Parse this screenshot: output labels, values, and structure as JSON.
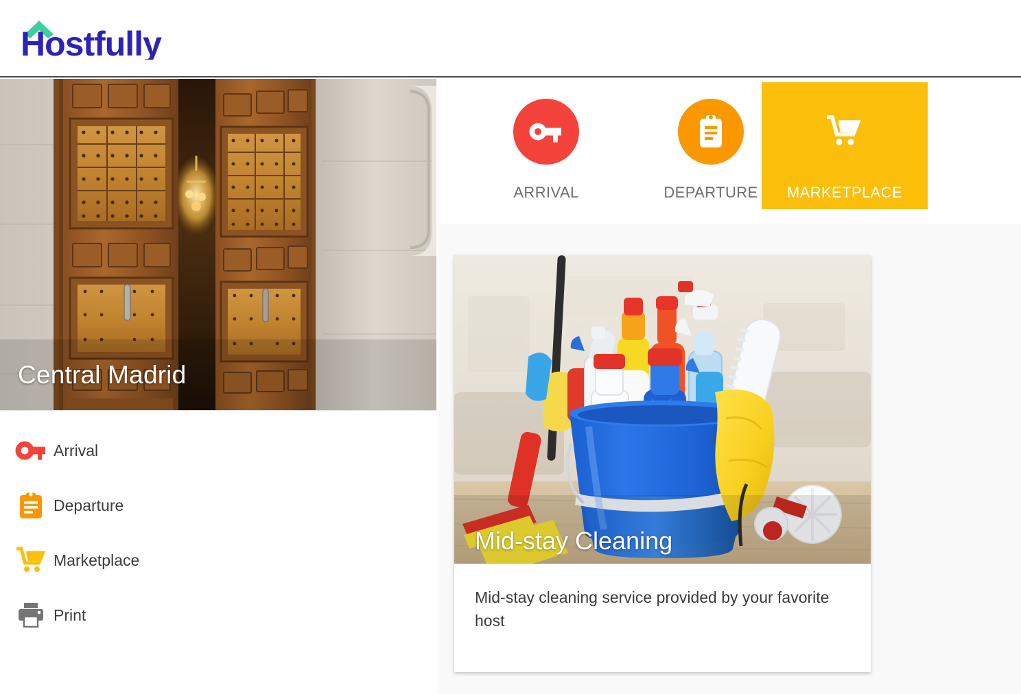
{
  "brand": {
    "name": "Hostfully",
    "logo_text": "Hostfully",
    "logo_roof_color": "#3ECEA0",
    "logo_text_color": "#2E23B8"
  },
  "property": {
    "hero_title": "Central Madrid",
    "hero_image_alt": "ornate-wooden-double-doors"
  },
  "sidebar": {
    "items": [
      {
        "label": "Arrival",
        "icon": "key-icon",
        "color": "#F4433B"
      },
      {
        "label": "Departure",
        "icon": "clipboard-icon",
        "color": "#FB9800"
      },
      {
        "label": "Marketplace",
        "icon": "shopping-cart-icon",
        "color": "#FBBE0B"
      },
      {
        "label": "Print",
        "icon": "printer-icon",
        "color": "#757575"
      }
    ]
  },
  "tabs": [
    {
      "label": "ARRIVAL",
      "icon": "key-icon",
      "active": false,
      "circle_color": "#F4433B"
    },
    {
      "label": "DEPARTURE",
      "icon": "clipboard-icon",
      "active": false,
      "circle_color": "#FB9800"
    },
    {
      "label": "MARKETPLACE",
      "icon": "shopping-cart-icon",
      "active": true,
      "circle_color": "#FBBE0B"
    }
  ],
  "marketplace": {
    "cards": [
      {
        "title": "Mid-stay Cleaning",
        "description": "Mid-stay cleaning service provided by your favorite host",
        "image_alt": "blue-bucket-with-cleaning-supplies"
      }
    ]
  },
  "colors": {
    "accent_yellow": "#FBBE0B",
    "accent_red": "#F4433B",
    "accent_orange": "#FB9800",
    "page_bg": "#F9F9FA",
    "text_primary": "#3C3C3C",
    "text_muted": "#6E6E6E"
  }
}
